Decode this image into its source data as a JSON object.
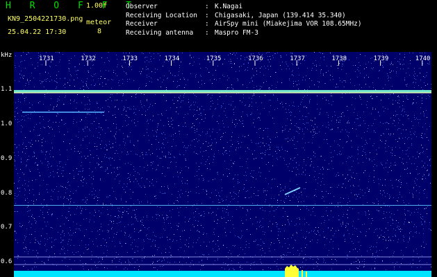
{
  "header": {
    "title": "H R O F F T",
    "version": "1.00f",
    "filename": "KN9_2504221730.png",
    "meteor_label": "meteor",
    "datetime": "25.04.22 17:30",
    "meteor_count": "8"
  },
  "info": [
    {
      "key": "Observer",
      "sep": ":",
      "value": "K.Nagai"
    },
    {
      "key": "Receiving Location",
      "sep": ":",
      "value": "Chigasaki, Japan (139.414 35.340)"
    },
    {
      "key": "Receiver",
      "sep": ":",
      "value": "AirSpy mini (Miakejima VOR 108.65MHz)"
    },
    {
      "key": "Receiving antenna",
      "sep": ":",
      "value": "Maspro FM-3"
    }
  ],
  "axis": {
    "unit": "kHz",
    "y_ticks": [
      "1.1",
      "1.0",
      "0.9",
      "0.8",
      "0.7",
      "0.6"
    ],
    "x_ticks": [
      "1731",
      "1732",
      "1733",
      "1734",
      "1735",
      "1736",
      "1737",
      "1738",
      "1739",
      "1740"
    ]
  },
  "colors": {
    "background": "#00006a",
    "carrier": "#7fffd4",
    "noise": "#4a7cff",
    "baseline": "#00e5ff",
    "label": "#ffffff",
    "accent": "#ffff66",
    "title": "#00e000"
  }
}
